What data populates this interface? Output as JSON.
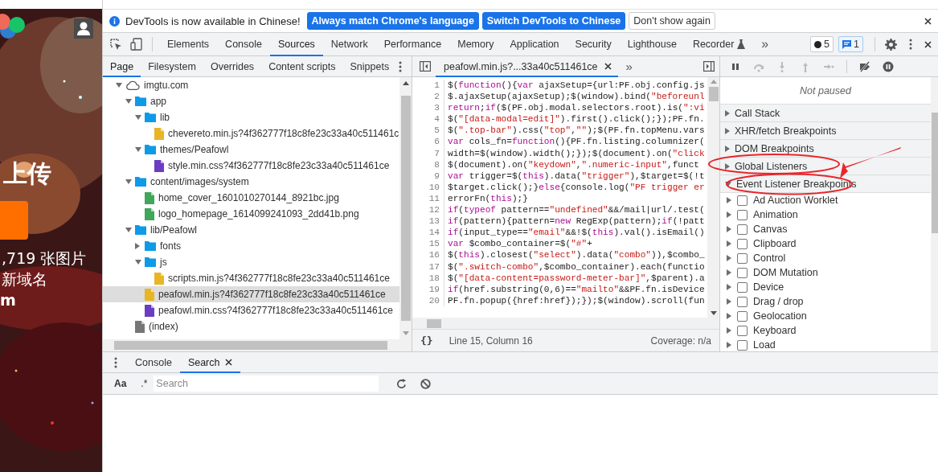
{
  "web_page": {
    "heading": "上传",
    "stat": ",719 张图片",
    "domain_note": "新域名",
    "domain_suffix": "m"
  },
  "infobar": {
    "message": "DevTools is now available in Chinese!",
    "buttons": [
      {
        "label": "Always match Chrome's language",
        "kind": "primary"
      },
      {
        "label": "Switch DevTools to Chinese",
        "kind": "primary"
      },
      {
        "label": "Don't show again",
        "kind": "secondary"
      }
    ]
  },
  "main_tabs": [
    {
      "label": "Elements",
      "selected": false,
      "kind": "plain"
    },
    {
      "label": "Console",
      "selected": false,
      "kind": "plain"
    },
    {
      "label": "Sources",
      "selected": true,
      "kind": "plain"
    },
    {
      "label": "Network",
      "selected": false,
      "kind": "plain"
    },
    {
      "label": "Performance",
      "selected": false,
      "kind": "plain"
    },
    {
      "label": "Memory",
      "selected": false,
      "kind": "plain"
    },
    {
      "label": "Application",
      "selected": false,
      "kind": "plain"
    },
    {
      "label": "Security",
      "selected": false,
      "kind": "plain"
    },
    {
      "label": "Lighthouse",
      "selected": false,
      "kind": "plain"
    },
    {
      "label": "Recorder",
      "selected": false,
      "kind": "experiment"
    }
  ],
  "more_tabs": "»",
  "error_count": "5",
  "message_count": "1",
  "navigator_tabs": [
    {
      "label": "Page",
      "selected": true
    },
    {
      "label": "Filesystem",
      "selected": false
    },
    {
      "label": "Overrides",
      "selected": false
    },
    {
      "label": "Content scripts",
      "selected": false
    },
    {
      "label": "Snippets",
      "selected": false
    }
  ],
  "file_tree": [
    {
      "label": "imgtu.com",
      "kind": "domain",
      "expanded": true,
      "selected": false,
      "children": [
        {
          "label": "app",
          "kind": "folder",
          "expanded": true,
          "selected": false,
          "children": [
            {
              "label": "lib",
              "kind": "folder",
              "expanded": true,
              "selected": false,
              "children": [
                {
                  "label": "chevereto.min.js?4f362777f18c8fe23c33a40c511461c",
                  "kind": "js",
                  "selected": false
                }
              ]
            },
            {
              "label": "themes/Peafowl",
              "kind": "folder",
              "expanded": true,
              "selected": false,
              "children": [
                {
                  "label": "style.min.css?4f362777f18c8fe23c33a40c511461ce",
                  "kind": "css",
                  "selected": false
                }
              ]
            }
          ]
        },
        {
          "label": "content/images/system",
          "kind": "folder",
          "expanded": true,
          "selected": false,
          "children": [
            {
              "label": "home_cover_1601010270144_8921bc.jpg",
              "selected": false
            },
            {
              "label": "logo_homepage_1614099241093_2dd41b.png",
              "selected": false
            }
          ]
        },
        {
          "label": "lib/Peafowl",
          "kind": "folder",
          "expanded": true,
          "selected": false,
          "children": [
            {
              "label": "fonts",
              "kind": "folder",
              "expanded": false,
              "selected": false
            },
            {
              "label": "js",
              "kind": "folder",
              "expanded": true,
              "selected": false,
              "children": [
                {
                  "label": "scripts.min.js?4f362777f18c8fe23c33a40c511461ce",
                  "kind": "js",
                  "selected": false
                }
              ]
            },
            {
              "label": "peafowl.min.js?4f362777f18c8fe23c33a40c511461ce",
              "kind": "js",
              "selected": true
            },
            {
              "label": "peafowl.min.css?4f362777f18c8fe23c33a40c511461ce",
              "kind": "css",
              "selected": false
            }
          ]
        },
        {
          "label": "(index)",
          "kind": "document",
          "selected": false
        }
      ]
    }
  ],
  "editor": {
    "file_tab": "peafowl.min.js?...33a40c511461ce",
    "more": "»",
    "lines": [
      {
        "number": "1",
        "code": "$(function(){var ajaxSetup={url:PF.obj.config.js"
      },
      {
        "number": "2",
        "code": "$.ajaxSetup(ajaxSetup);$(window).bind(\"beforeunl"
      },
      {
        "number": "3",
        "code": "return;if($(PF.obj.modal.selectors.root).is(\":vi"
      },
      {
        "number": "4",
        "code": "$(\"[data-modal=edit]\").first().click();});PF.fn."
      },
      {
        "number": "5",
        "code": "$(\".top-bar\").css(\"top\",\"\");$(PF.fn.topMenu.vars"
      },
      {
        "number": "6",
        "code": "var cols_fn=function(){PF.fn.listing.columnizer("
      },
      {
        "number": "7",
        "code": "width=$(window).width();});$(document).on(\"click"
      },
      {
        "number": "8",
        "code": "$(document).on(\"keydown\",\".numeric-input\",funct"
      },
      {
        "number": "9",
        "code": "var trigger=$(this).data(\"trigger\"),$target=$(!t"
      },
      {
        "number": "10",
        "code": "$target.click();}else{console.log(\"PF trigger er"
      },
      {
        "number": "11",
        "code": "errorFn(this);}"
      },
      {
        "number": "12",
        "code": "if(typeof pattern==\"undefined\"&&/mail|url/.test("
      },
      {
        "number": "13",
        "code": "if(pattern){pattern=new RegExp(pattern);if(!patt"
      },
      {
        "number": "14",
        "code": "if(input_type==\"email\"&&!$(this).val().isEmail()"
      },
      {
        "number": "15",
        "code": "var $combo_container=$(\"#\"+"
      },
      {
        "number": "16",
        "code": "$(this).closest(\"select\").data(\"combo\")),$combo_"
      },
      {
        "number": "17",
        "code": "$(\".switch-combo\",$combo_container).each(functio"
      },
      {
        "number": "18",
        "code": "$(\"[data-content=password-meter-bar]\",$parent).a"
      },
      {
        "number": "19",
        "code": "if(href.substring(0,6)==\"mailto\"&&PF.fn.isDevice"
      },
      {
        "number": "20",
        "code": "PF.fn.popup({href:href});});$(window).scroll(fun"
      }
    ],
    "status": {
      "format": "{}",
      "position": "Line 15, Column 16",
      "coverage": "Coverage: n/a"
    }
  },
  "debugger": {
    "status": "Not paused",
    "sections": [
      {
        "label": "Call Stack",
        "expanded": false
      },
      {
        "label": "XHR/fetch Breakpoints",
        "expanded": false
      },
      {
        "label": "DOM Breakpoints",
        "expanded": false
      },
      {
        "label": "Global Listeners",
        "expanded": false
      },
      {
        "label": "Event Listener Breakpoints",
        "expanded": true
      }
    ],
    "event_categories": [
      {
        "label": "Ad Auction Worklet",
        "checked": false
      },
      {
        "label": "Animation",
        "checked": false
      },
      {
        "label": "Canvas",
        "checked": false
      },
      {
        "label": "Clipboard",
        "checked": false
      },
      {
        "label": "Control",
        "checked": false
      },
      {
        "label": "DOM Mutation",
        "checked": false
      },
      {
        "label": "Device",
        "checked": false
      },
      {
        "label": "Drag / drop",
        "checked": false
      },
      {
        "label": "Geolocation",
        "checked": false
      },
      {
        "label": "Keyboard",
        "checked": false
      },
      {
        "label": "Load",
        "checked": false
      }
    ]
  },
  "drawer": {
    "tabs": [
      {
        "label": "Console",
        "selected": false,
        "closable": false
      },
      {
        "label": "Search",
        "selected": true,
        "closable": true
      }
    ],
    "search": {
      "case_toggle": "Aa",
      "regex_toggle": ".*",
      "placeholder": "Search"
    }
  }
}
